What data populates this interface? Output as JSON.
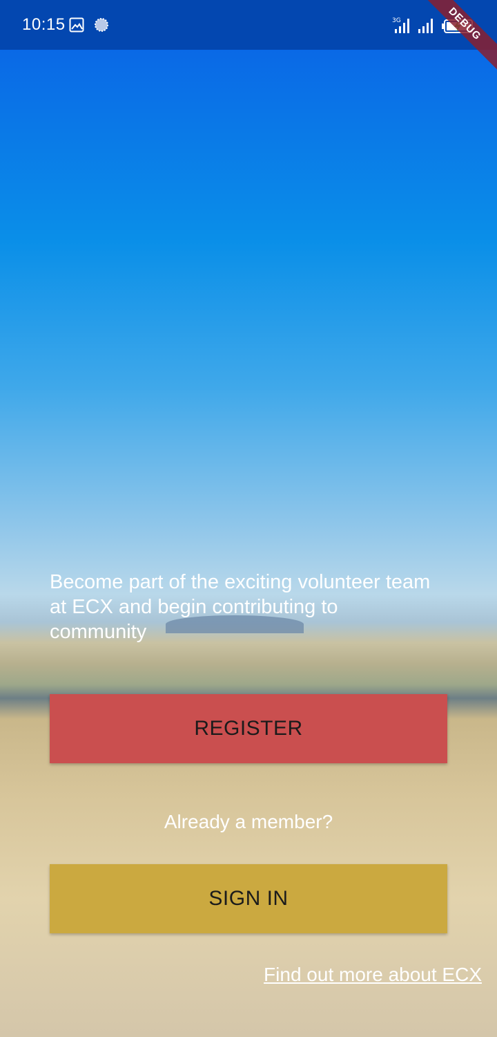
{
  "status_bar": {
    "time": "10:15",
    "network_label": "3G",
    "icons": [
      "image-icon",
      "loading-icon",
      "signal-3g-icon",
      "signal-icon",
      "battery-charging-icon"
    ]
  },
  "debug_banner": "DEBUG",
  "intro": {
    "tagline": "Become part of the exciting volunteer team at ECX and begin contributing to community"
  },
  "actions": {
    "register_label": "REGISTER",
    "member_prompt": "Already a member?",
    "signin_label": "SIGN IN",
    "more_link": "Find out more about ECX"
  },
  "colors": {
    "status_bar": "#0347b0",
    "register_button": "#ca4f4f",
    "signin_button": "#cba940",
    "debug_banner": "#882030"
  }
}
